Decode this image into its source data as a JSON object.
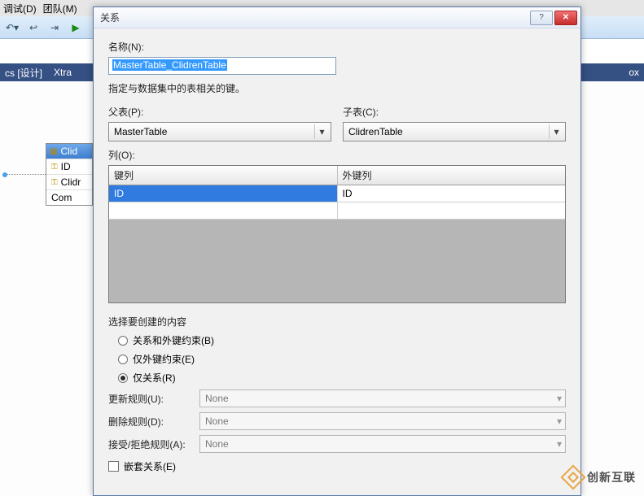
{
  "ide": {
    "menu": {
      "debug": "调试(D)",
      "team": "团队(M)"
    },
    "tabs": {
      "design": "cs [设计]",
      "xtra": "Xtra",
      "right": "ox"
    },
    "table": {
      "title": "Clid",
      "rows": [
        "ID",
        "Clidr",
        "Com"
      ]
    }
  },
  "dialog": {
    "title": "关系",
    "name_label": "名称(N):",
    "name_value": "MasterTable_ClidrenTable",
    "hint": "指定与数据集中的表相关的键。",
    "parent_label": "父表(P):",
    "parent_value": "MasterTable",
    "child_label": "子表(C):",
    "child_value": "ClidrenTable",
    "cols_label": "列(O):",
    "grid": {
      "headers": [
        "键列",
        "外键列"
      ],
      "rows": [
        {
          "key": "ID",
          "fkey": "ID",
          "selected": true
        }
      ]
    },
    "create_label": "选择要创建的内容",
    "radios": [
      {
        "label": "关系和外键约束(B)",
        "checked": false
      },
      {
        "label": "仅外键约束(E)",
        "checked": false
      },
      {
        "label": "仅关系(R)",
        "checked": true
      }
    ],
    "rules": {
      "update_label": "更新规则(U):",
      "update_value": "None",
      "delete_label": "删除规则(D):",
      "delete_value": "None",
      "accept_label": "接受/拒绝规则(A):",
      "accept_value": "None"
    },
    "nested_label": "嵌套关系(E)"
  },
  "watermark": {
    "text": "创新互联"
  }
}
